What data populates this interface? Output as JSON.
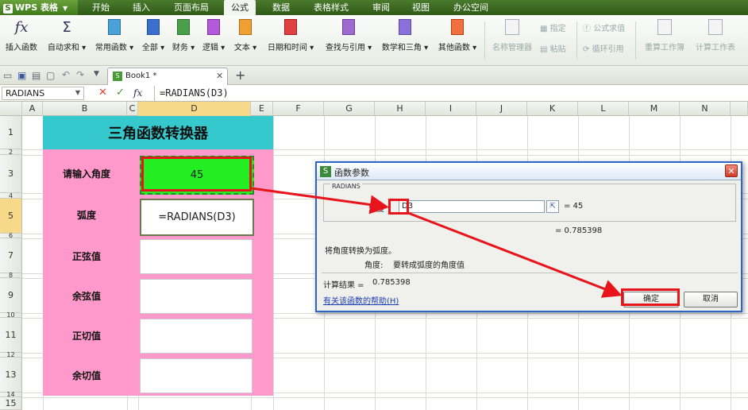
{
  "app": {
    "name": "WPS 表格"
  },
  "menu": {
    "tabs": [
      "开始",
      "插入",
      "页面布局",
      "公式",
      "数据",
      "表格样式",
      "审阅",
      "视图",
      "办公空间"
    ],
    "active": "公式"
  },
  "ribbon": {
    "insert_function": "插入函数",
    "autosum": "自动求和",
    "common": "常用函数",
    "all": "全部",
    "finance": "财务",
    "logic": "逻辑",
    "text": "文本",
    "datetime": "日期和时间",
    "lookup": "查找与引用",
    "math": "数学和三角",
    "other": "其他函数",
    "name_manager": "名称管理器",
    "assign": "指定",
    "paste": "粘贴",
    "formula_eval": "公式求值",
    "circular": "循环引用",
    "recalc_book": "重算工作簿",
    "recalc_sheet": "计算工作表"
  },
  "tab": {
    "book": "Book1 *"
  },
  "formula_bar": {
    "name_box": "RADIANS",
    "fx": "fx",
    "formula": "=RADIANS(D3)"
  },
  "columns": [
    "A",
    "B",
    "C",
    "D",
    "E",
    "F",
    "G",
    "H",
    "I",
    "J",
    "K",
    "L",
    "M",
    "N"
  ],
  "rows": [
    "1",
    "2",
    "3",
    "4",
    "5",
    "6",
    "7",
    "8",
    "9",
    "10",
    "11",
    "12",
    "13",
    "14",
    "15"
  ],
  "converter": {
    "title": "三角函数转换器",
    "labels": [
      "请输入角度",
      "弧度",
      "正弦值",
      "余弦值",
      "正切值",
      "余切值"
    ],
    "angle_value": "45",
    "radian_formula": "=RADIANS(D3)"
  },
  "dialog": {
    "title": "函数参数",
    "group": "RADIANS",
    "arg_label": "角度",
    "arg_value": "D3",
    "arg_result": "= 45",
    "func_result": "= 0.785398",
    "desc": "将角度转换为弧度。",
    "arg_desc_label": "角度:",
    "arg_desc": "要转成弧度的角度值",
    "calc_label": "计算结果 =",
    "calc_value": "0.785398",
    "help_link": "有关该函数的帮助(H)",
    "ok": "确定",
    "cancel": "取消"
  },
  "colors": {
    "accent_red": "#e8141c",
    "title_bg": "#35c8cc",
    "panel_bg": "#ff99cc",
    "input_bg": "#22ee22"
  }
}
